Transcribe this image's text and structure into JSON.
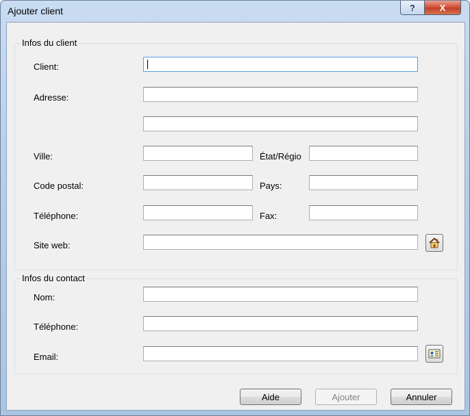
{
  "window": {
    "title": "Ajouter client",
    "help_glyph": "?",
    "close_glyph": "X"
  },
  "client_group": {
    "legend": "Infos du client",
    "client_label": "Client:",
    "client_value": "",
    "address_label": "Adresse:",
    "address1_value": "",
    "address2_value": "",
    "city_label": "Ville:",
    "city_value": "",
    "state_label": "État/Régio",
    "state_value": "",
    "postal_label": "Code postal:",
    "postal_value": "",
    "country_label": "Pays:",
    "country_value": "",
    "phone_label": "Téléphone:",
    "phone_value": "",
    "fax_label": "Fax:",
    "fax_value": "",
    "website_label": "Site web:",
    "website_value": "",
    "website_button_icon": "home-icon"
  },
  "contact_group": {
    "legend": "Infos du contact",
    "name_label": "Nom:",
    "name_value": "",
    "phone_label": "Téléphone:",
    "phone_value": "",
    "email_label": "Email:",
    "email_value": "",
    "email_button_icon": "address-card-icon"
  },
  "buttons": {
    "help": "Aide",
    "add": "Ajouter",
    "cancel": "Annuler"
  }
}
